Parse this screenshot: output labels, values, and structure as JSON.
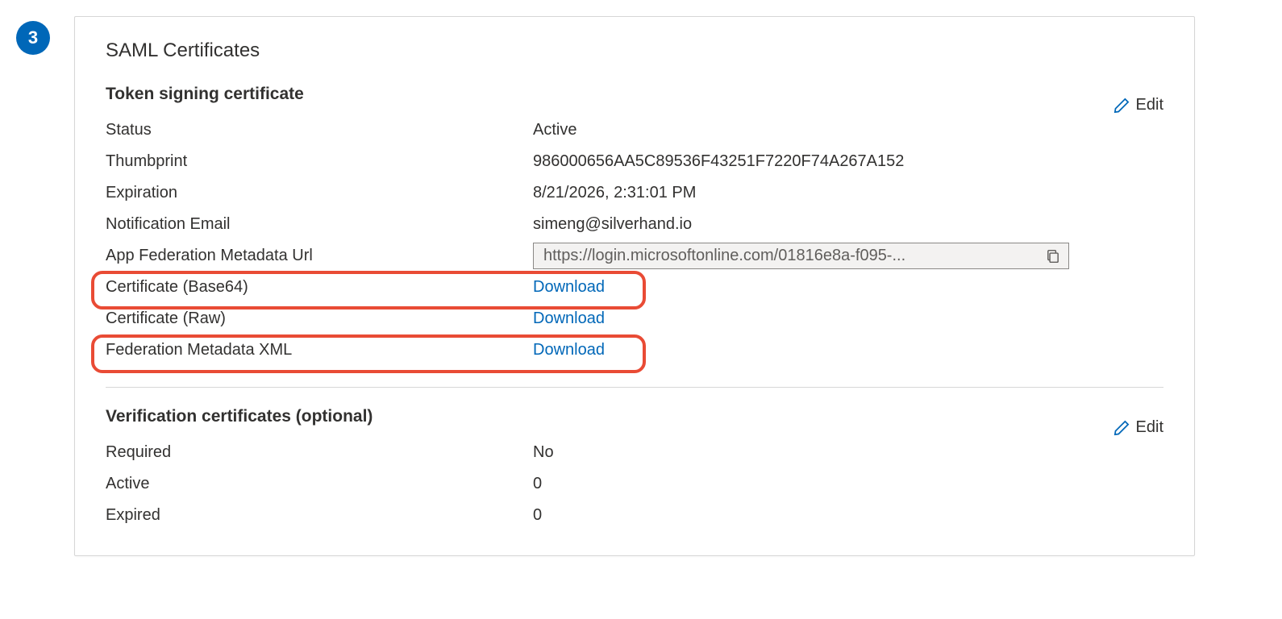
{
  "step_number": "3",
  "card": {
    "title": "SAML Certificates",
    "edit_label": "Edit",
    "token_signing": {
      "title": "Token signing certificate",
      "rows": {
        "status": {
          "label": "Status",
          "value": "Active"
        },
        "thumbprint": {
          "label": "Thumbprint",
          "value": "986000656AA5C89536F43251F7220F74A267A152"
        },
        "expiration": {
          "label": "Expiration",
          "value": "8/21/2026, 2:31:01 PM"
        },
        "notification_email": {
          "label": "Notification Email",
          "value": "simeng@silverhand.io"
        },
        "metadata_url": {
          "label": "App Federation Metadata Url",
          "value": "https://login.microsoftonline.com/01816e8a-f095-..."
        },
        "cert_base64": {
          "label": "Certificate (Base64)",
          "link": "Download"
        },
        "cert_raw": {
          "label": "Certificate (Raw)",
          "link": "Download"
        },
        "fed_xml": {
          "label": "Federation Metadata XML",
          "link": "Download"
        }
      }
    },
    "verification": {
      "title": "Verification certificates (optional)",
      "rows": {
        "required": {
          "label": "Required",
          "value": "No"
        },
        "active": {
          "label": "Active",
          "value": "0"
        },
        "expired": {
          "label": "Expired",
          "value": "0"
        }
      }
    }
  }
}
